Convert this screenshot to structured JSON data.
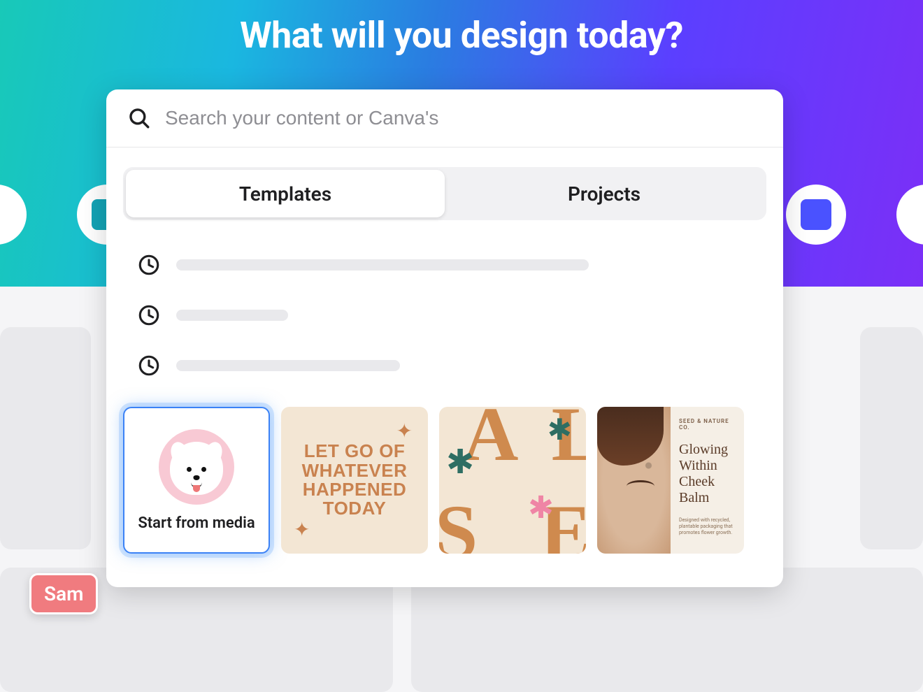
{
  "hero": {
    "title": "What will you design today?"
  },
  "search": {
    "placeholder": "Search your content or Canva's"
  },
  "tabs": {
    "templates": "Templates",
    "projects": "Projects"
  },
  "start_card": {
    "label": "Start from media"
  },
  "templates": {
    "tpl1": {
      "line1": "LET GO OF",
      "line2": "WHATEVER",
      "line3": "HAPPENED",
      "line4": "TODAY"
    },
    "tpl2": {
      "letters": {
        "a": "A",
        "l": "L",
        "s": "S",
        "e": "E"
      }
    },
    "tpl3": {
      "brand": "SEED & NATURE CO.",
      "headline": "Glowing Within Cheek Balm",
      "desc": "Designed with recycled, plantable packaging that promotes flower growth."
    }
  },
  "cursor": {
    "user": "Sam"
  }
}
